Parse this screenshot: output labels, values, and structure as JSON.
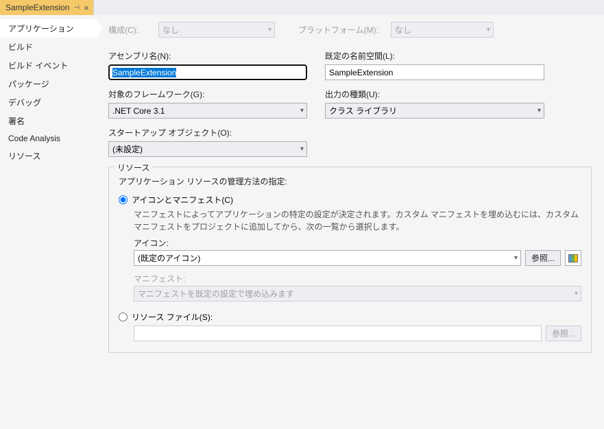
{
  "tab": {
    "title": "SampleExtension"
  },
  "sidebar": {
    "items": [
      {
        "label": "アプリケーション"
      },
      {
        "label": "ビルド"
      },
      {
        "label": "ビルド イベント"
      },
      {
        "label": "パッケージ"
      },
      {
        "label": "デバッグ"
      },
      {
        "label": "署名"
      },
      {
        "label": "Code Analysis"
      },
      {
        "label": "リソース"
      }
    ]
  },
  "top": {
    "config_label": "構成(C):",
    "config_value": "なし",
    "platform_label": "プラットフォーム(M):",
    "platform_value": "なし"
  },
  "form": {
    "assembly_label": "アセンブリ名(N):",
    "assembly_value": "SampleExtension",
    "namespace_label": "既定の名前空間(L):",
    "namespace_value": "SampleExtension",
    "framework_label": "対象のフレームワーク(G):",
    "framework_value": ".NET Core 3.1",
    "output_label": "出力の種類(U):",
    "output_value": "クラス ライブラリ",
    "startup_label": "スタートアップ オブジェクト(O):",
    "startup_value": "(未設定)"
  },
  "resources": {
    "group_title": "リソース",
    "desc": "アプリケーション リソースの管理方法の指定:",
    "radio_icon": "アイコンとマニフェスト(C)",
    "icon_help": "マニフェストによってアプリケーションの特定の設定が決定されます。カスタム マニフェストを埋め込むには、カスタム マニフェストをプロジェクトに追加してから、次の一覧から選択します。",
    "icon_label": "アイコン:",
    "icon_value": "(既定のアイコン)",
    "browse": "参照...",
    "manifest_label": "マニフェスト:",
    "manifest_value": "マニフェストを既定の設定で埋め込みます",
    "radio_resfile": "リソース ファイル(S):",
    "browse2": "参照..."
  }
}
